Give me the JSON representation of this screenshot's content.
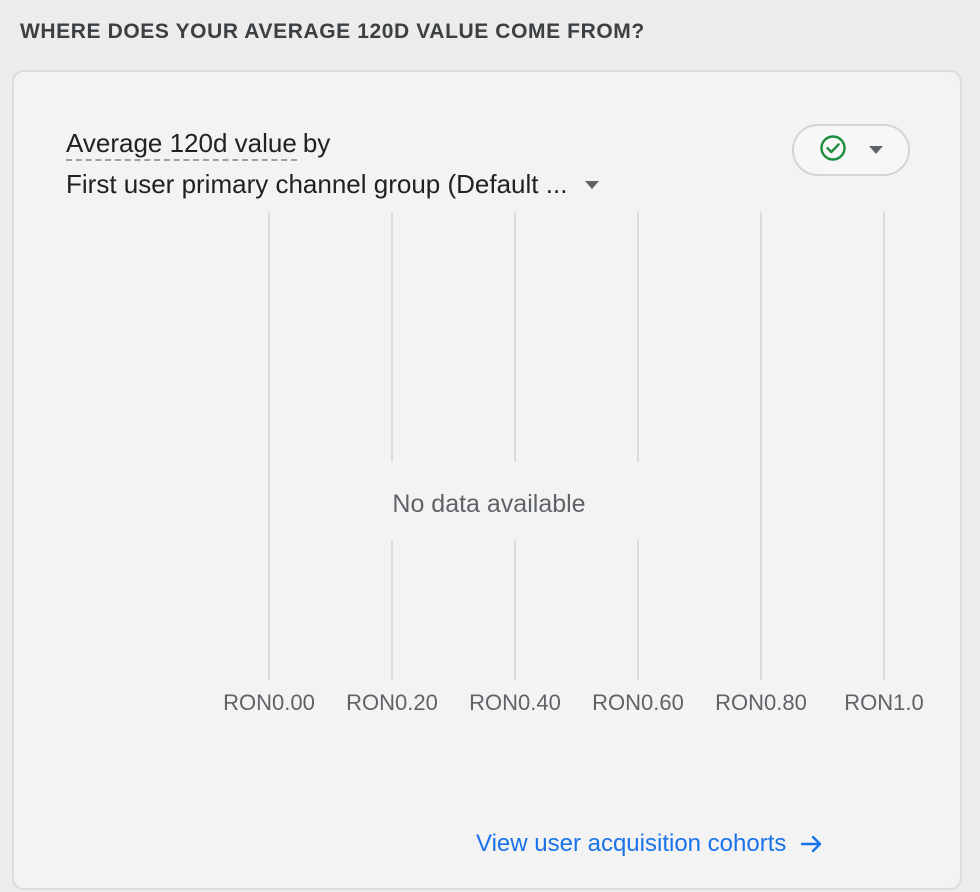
{
  "section": {
    "title": "WHERE DOES YOUR AVERAGE 120D VALUE COME FROM?"
  },
  "card": {
    "metric_label": "Average 120d value",
    "metric_by": "by",
    "dimension_label": "First user primary channel group (Default ...",
    "status_icon": "check-circle-icon",
    "no_data_text": "No data available",
    "link_label": "View user acquisition cohorts",
    "link_icon": "arrow-right-icon"
  },
  "colors": {
    "accent": "#1a73e8",
    "status_green": "#1e8e3e"
  },
  "chart_data": {
    "type": "bar",
    "categories": [],
    "values": [],
    "title": "",
    "xlabel": "",
    "ylabel": "",
    "xlim": [
      0,
      1.0
    ],
    "x_ticks": [
      "RON0.00",
      "RON0.20",
      "RON0.40",
      "RON0.60",
      "RON0.80",
      "RON1.0"
    ],
    "grid": true,
    "annotation": "No data available"
  }
}
